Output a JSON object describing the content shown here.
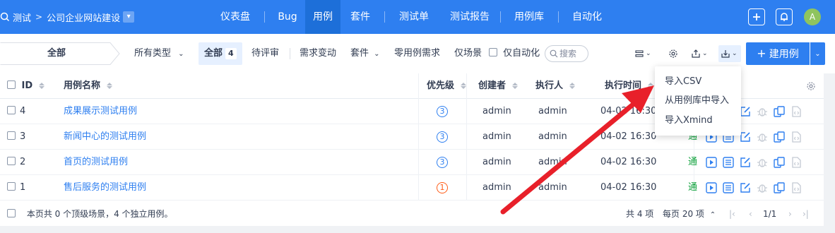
{
  "breadcrumb": {
    "product": "测试",
    "project": "公司企业网站建设"
  },
  "nav": {
    "items": [
      "仪表盘",
      "Bug",
      "用例",
      "套件",
      "测试单",
      "测试报告",
      "用例库",
      "自动化"
    ],
    "active_index": 2
  },
  "user": {
    "avatar_letter": "A"
  },
  "filter": {
    "scope": "全部",
    "type": "所有类型",
    "all_label": "全部",
    "all_count": "4",
    "tabs": [
      "待评审",
      "需求变动",
      "套件",
      "零用例需求",
      "仅场景"
    ],
    "auto_only": "仅自动化",
    "search": "搜索"
  },
  "create_button": "建用例",
  "table": {
    "headers": {
      "id": "ID",
      "title": "用例名称",
      "pri": "优先级",
      "creator": "创建者",
      "executor": "执行人",
      "exec_time": "执行时间"
    },
    "rows": [
      {
        "id": "4",
        "title": "成果展示测试用例",
        "pri": "3",
        "creator": "admin",
        "executor": "admin",
        "time": "04-02 16:30"
      },
      {
        "id": "3",
        "title": "新闻中心的测试用例",
        "pri": "3",
        "creator": "admin",
        "executor": "admin",
        "time": "04-02 16:30"
      },
      {
        "id": "2",
        "title": "首页的测试用例",
        "pri": "3",
        "creator": "admin",
        "executor": "admin",
        "time": "04-02 16:30"
      },
      {
        "id": "1",
        "title": "售后服务的测试用例",
        "pri": "1",
        "creator": "admin",
        "executor": "admin",
        "time": "04-02 16:30"
      }
    ],
    "status_fragment": "通",
    "footer": {
      "summary": "本页共 0 个顶级场景，4 个独立用例。",
      "total": "共 4 项",
      "per_page": "每页 20 项",
      "page": "1/1"
    }
  },
  "import_menu": {
    "items": [
      "导入CSV",
      "从用例库中导入",
      "导入Xmind"
    ]
  },
  "colors": {
    "primary": "#2e7ff0",
    "nav_active": "#1d6fd9",
    "arrow": "#e8202a",
    "pri_high": "#ff5d18"
  }
}
